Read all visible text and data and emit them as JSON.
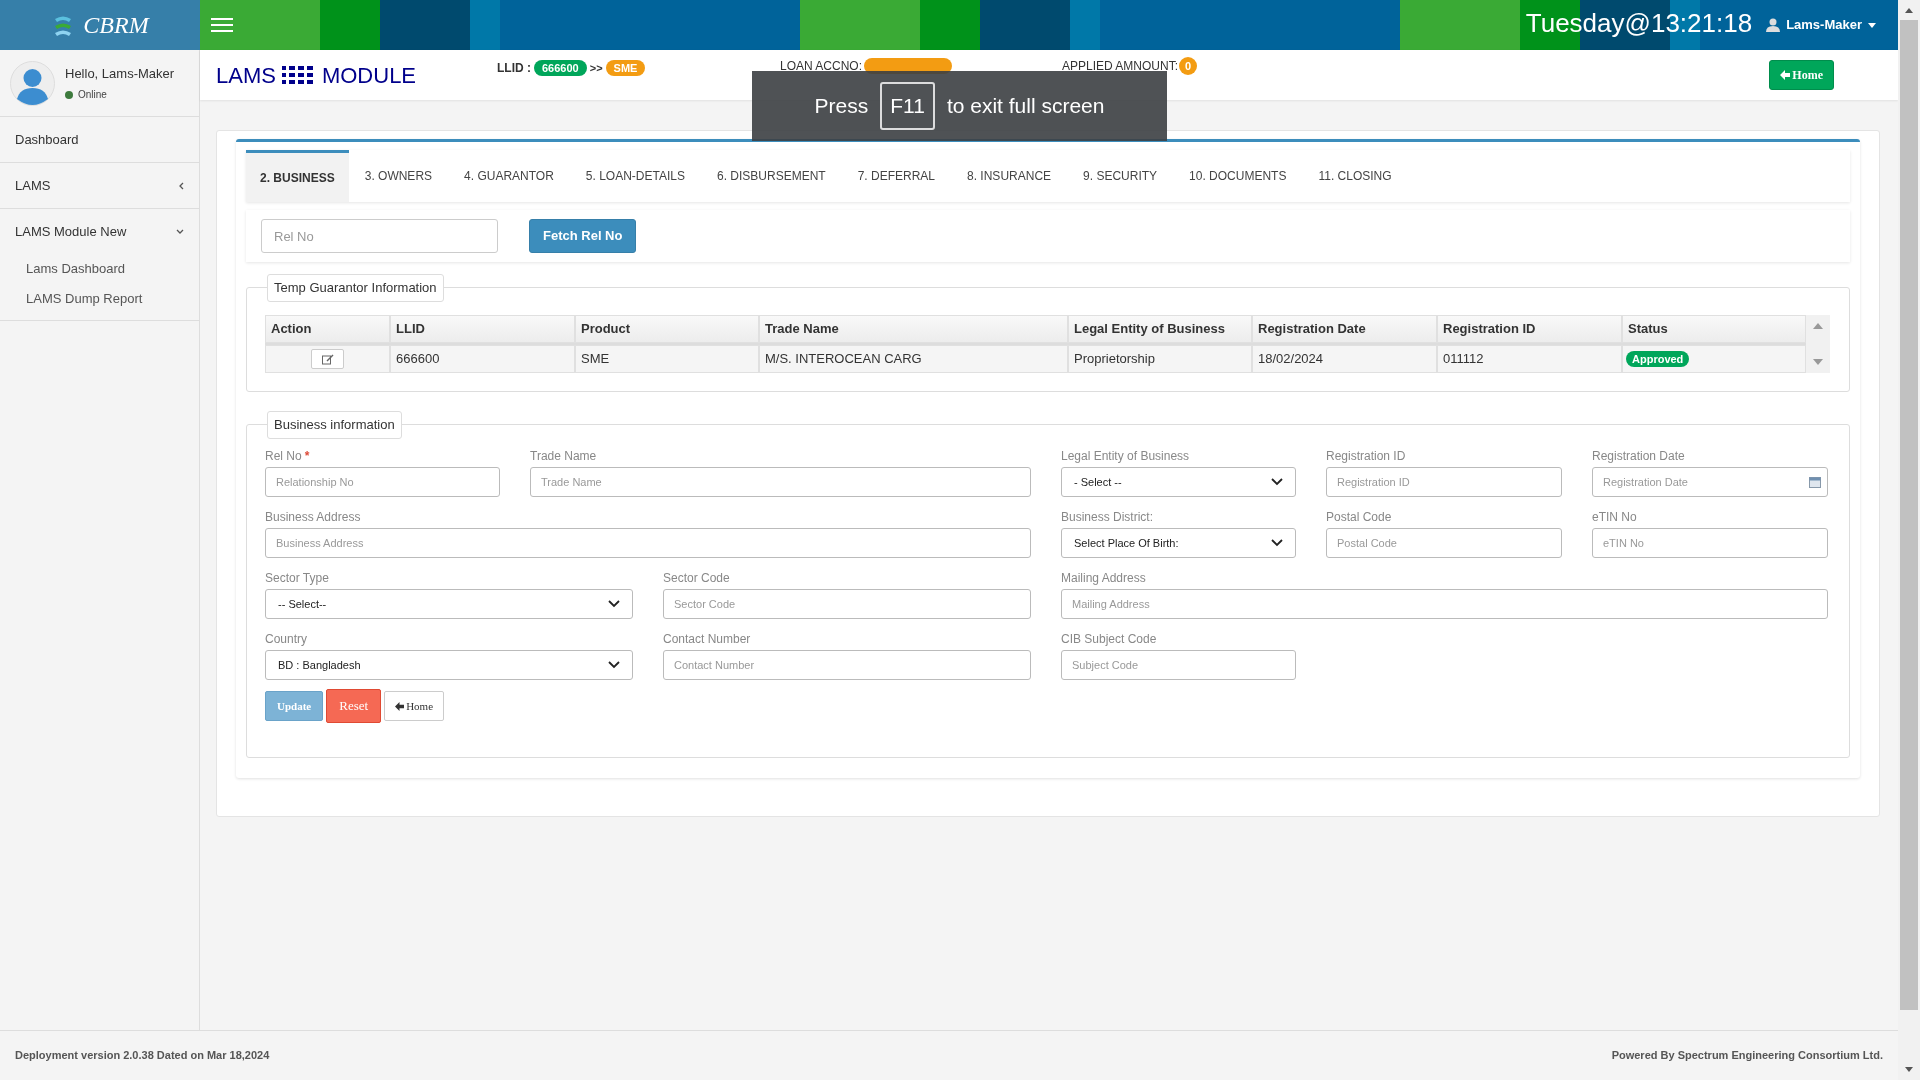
{
  "top_bar": {
    "logo": "CBRM",
    "clock": "Tuesday@13:21:18",
    "user": "Lams-Maker"
  },
  "sidebar": {
    "greeting": "Hello, Lams-Maker",
    "status": "Online",
    "items": [
      {
        "label": "Dashboard",
        "has_caret": false
      },
      {
        "label": "LAMS",
        "expanded": false,
        "has_caret": true
      },
      {
        "label": "LAMS Module New",
        "expanded": true,
        "has_caret": true,
        "children": [
          {
            "label": "Lams Dashboard"
          },
          {
            "label": "LAMS Dump Report"
          }
        ]
      }
    ]
  },
  "header": {
    "title_left": "LAMS",
    "title_right": "MODULE",
    "llid_label": "LLID :",
    "llid": "666600",
    "separator": ">>",
    "product": "SME",
    "loan_accno_label": "LOAN ACCNO:",
    "applied_amount_label": "APPLIED AMNOUNT:",
    "applied_amount": "0",
    "home_button": "Home"
  },
  "fullscreen_notice": {
    "before": "Press",
    "key": "F11",
    "after": "to exit full screen"
  },
  "tabs": [
    {
      "label": "2. BUSINESS",
      "selected": true
    },
    {
      "label": "3. OWNERS",
      "selected": false
    },
    {
      "label": "4. GUARANTOR",
      "selected": false
    },
    {
      "label": "5. LOAN-DETAILS",
      "selected": false
    },
    {
      "label": "6. DISBURSEMENT",
      "selected": false
    },
    {
      "label": "7. DEFERRAL",
      "selected": false
    },
    {
      "label": "8. INSURANCE",
      "selected": false
    },
    {
      "label": "9. SECURITY",
      "selected": false
    },
    {
      "label": "10. DOCUMENTS",
      "selected": false
    },
    {
      "label": "11. CLOSING",
      "selected": false
    }
  ],
  "fetch": {
    "placeholder": "Rel No",
    "button": "Fetch Rel No"
  },
  "guarantor_table": {
    "legend": "Temp Guarantor Information",
    "columns": [
      "Action",
      "LLID",
      "Product",
      "Trade Name",
      "Legal Entity of Business",
      "Registration Date",
      "Registration ID",
      "Status"
    ],
    "rows": [
      {
        "llid": "666600",
        "product": "SME",
        "trade_name": "M/S. INTEROCEAN CARG",
        "legal_entity": "Proprietorship",
        "registration_date": "18/02/2024",
        "registration_id": "011112",
        "status": "Approved"
      }
    ]
  },
  "business_form": {
    "legend": "Business information",
    "fields": [
      {
        "kind": "text",
        "label": "Rel No",
        "mark": "*",
        "placeholder": "Relationship No"
      },
      {
        "kind": "text",
        "label": "Trade Name",
        "placeholder": "Trade Name"
      },
      {
        "kind": "select",
        "label": "Legal Entity of Business",
        "value": "- Select --"
      },
      {
        "kind": "text",
        "label": "Registration ID",
        "placeholder": "Registration ID"
      },
      {
        "kind": "date",
        "label": "Registration Date",
        "placeholder": "Registration Date"
      },
      {
        "kind": "text",
        "label": "Business Address",
        "placeholder": "Business Address"
      },
      {
        "kind": "select",
        "label": "Business District:",
        "value": "Select Place Of Birth:"
      },
      {
        "kind": "text",
        "label": "Postal Code",
        "placeholder": "Postal Code"
      },
      {
        "kind": "text",
        "label": "eTIN No",
        "placeholder": "eTIN No"
      },
      {
        "kind": "select",
        "label": "Sector Type",
        "value": "-- Select--"
      },
      {
        "kind": "text",
        "label": "Sector Code",
        "placeholder": "Sector Code"
      },
      {
        "kind": "text",
        "label": "Mailing Address",
        "placeholder": "Mailing Address"
      },
      {
        "kind": "select",
        "label": "Country",
        "value": "BD : Bangladesh"
      },
      {
        "kind": "text",
        "label": "Contact Number",
        "placeholder": "Contact Number"
      },
      {
        "kind": "text",
        "label": "CIB Subject Code",
        "placeholder": "Subject Code"
      }
    ],
    "buttons": [
      {
        "kind": "update",
        "label": "Update"
      },
      {
        "kind": "reset",
        "label": "Reset"
      },
      {
        "kind": "home",
        "label": "Home"
      }
    ]
  },
  "footer": {
    "left": "Deployment version 2.0.38 Dated on Mar 18,2024",
    "right": "Powered By Spectrum Engineering Consortium Ltd."
  }
}
